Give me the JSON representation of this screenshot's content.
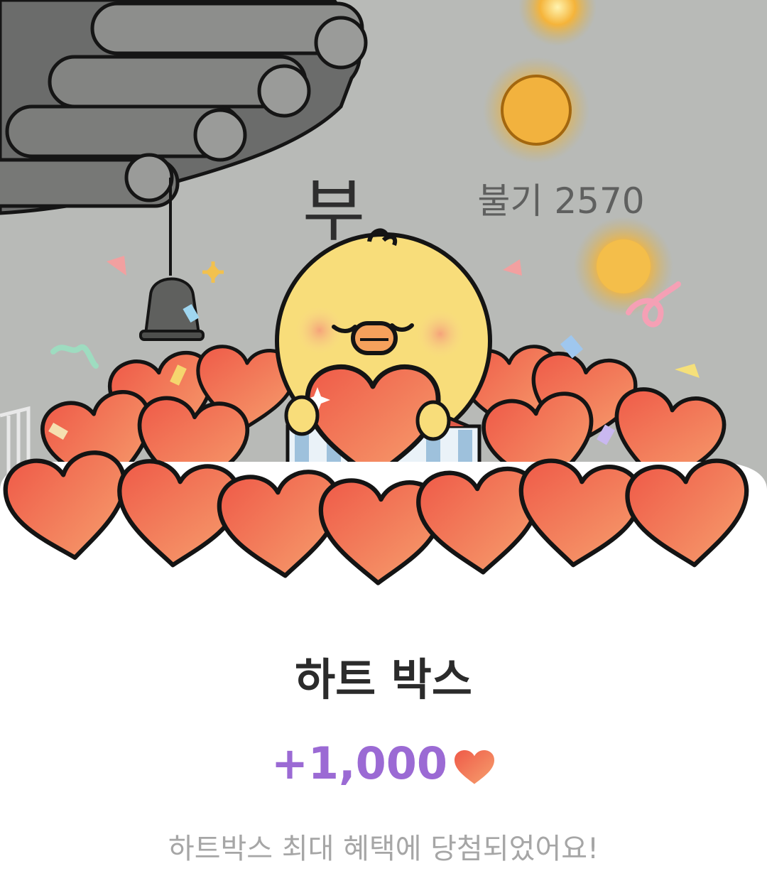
{
  "banner": {
    "sign_char": "부",
    "background_caption": "불기 2570"
  },
  "reward": {
    "title": "하트 박스",
    "amount": "+1,000",
    "amount_icon": "heart-icon",
    "message": "하트박스 최대 혜택에 당첨되었어요!"
  },
  "colors": {
    "amount": "#9b6ad4",
    "title": "#2b2b2b",
    "message": "#a6a6a6",
    "heart_top": "#f59a6a",
    "heart_bottom": "#ec5a45",
    "background_gray": "#b9bbb8"
  }
}
